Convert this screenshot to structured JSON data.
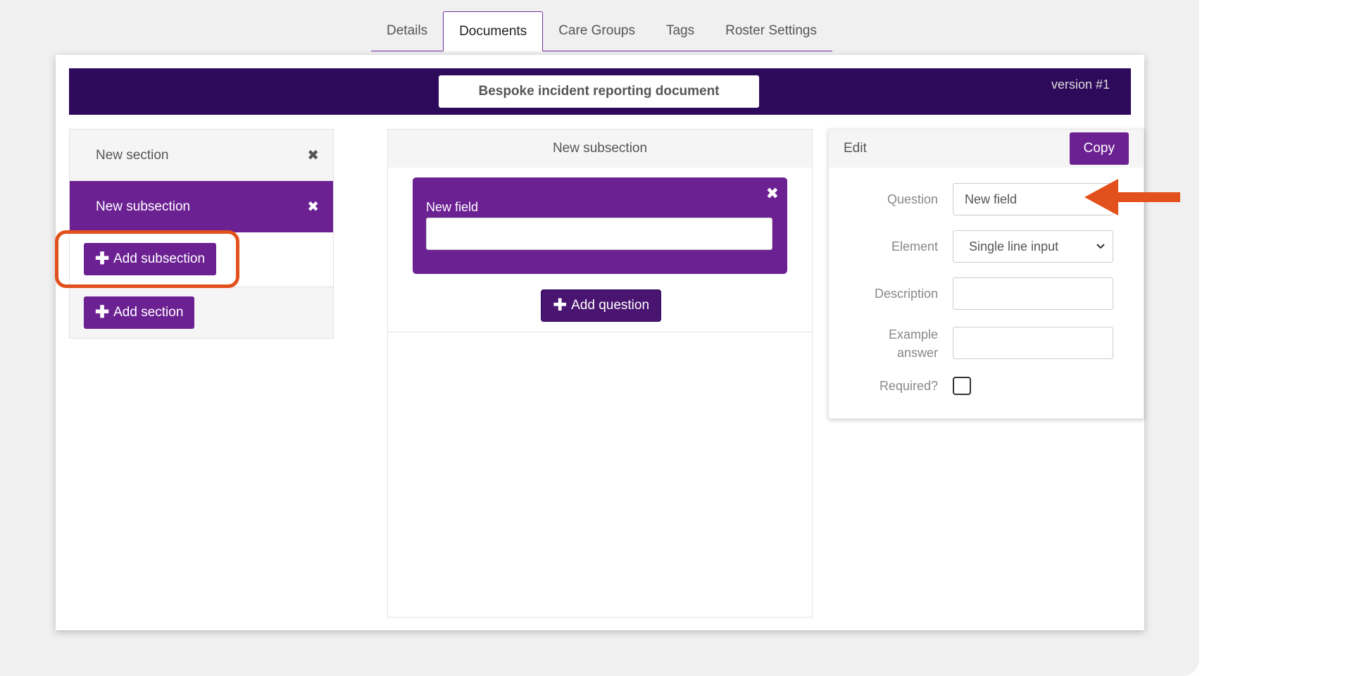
{
  "tabs": [
    {
      "label": "Details"
    },
    {
      "label": "Documents"
    },
    {
      "label": "Care Groups"
    },
    {
      "label": "Tags"
    },
    {
      "label": "Roster Settings"
    }
  ],
  "document": {
    "title": "Bespoke incident reporting document",
    "version": "version #1"
  },
  "sections": {
    "items": [
      {
        "label": "New section"
      },
      {
        "label": "New subsection"
      }
    ],
    "remove_symbol": "✖",
    "add_subsection_label": "Add subsection",
    "add_section_label": "Add section",
    "plus_symbol": "✚"
  },
  "subsection": {
    "title": "New subsection",
    "field_label": "New field",
    "field_remove_symbol": "✖",
    "add_question_label": "Add question"
  },
  "edit": {
    "title": "Edit",
    "copy_label": "Copy",
    "question_label": "Question",
    "question_value": "New field",
    "element_label": "Element",
    "element_value": "Single line input",
    "description_label": "Description",
    "example_label_line1": "Example",
    "example_label_line2": "answer",
    "required_label": "Required?"
  },
  "annotation": {
    "highlight_color": "#e2501c",
    "arrow_color": "#e2501c"
  },
  "colors": {
    "header_bg": "#2e0a5b",
    "accent_purple": "#6c2193"
  }
}
